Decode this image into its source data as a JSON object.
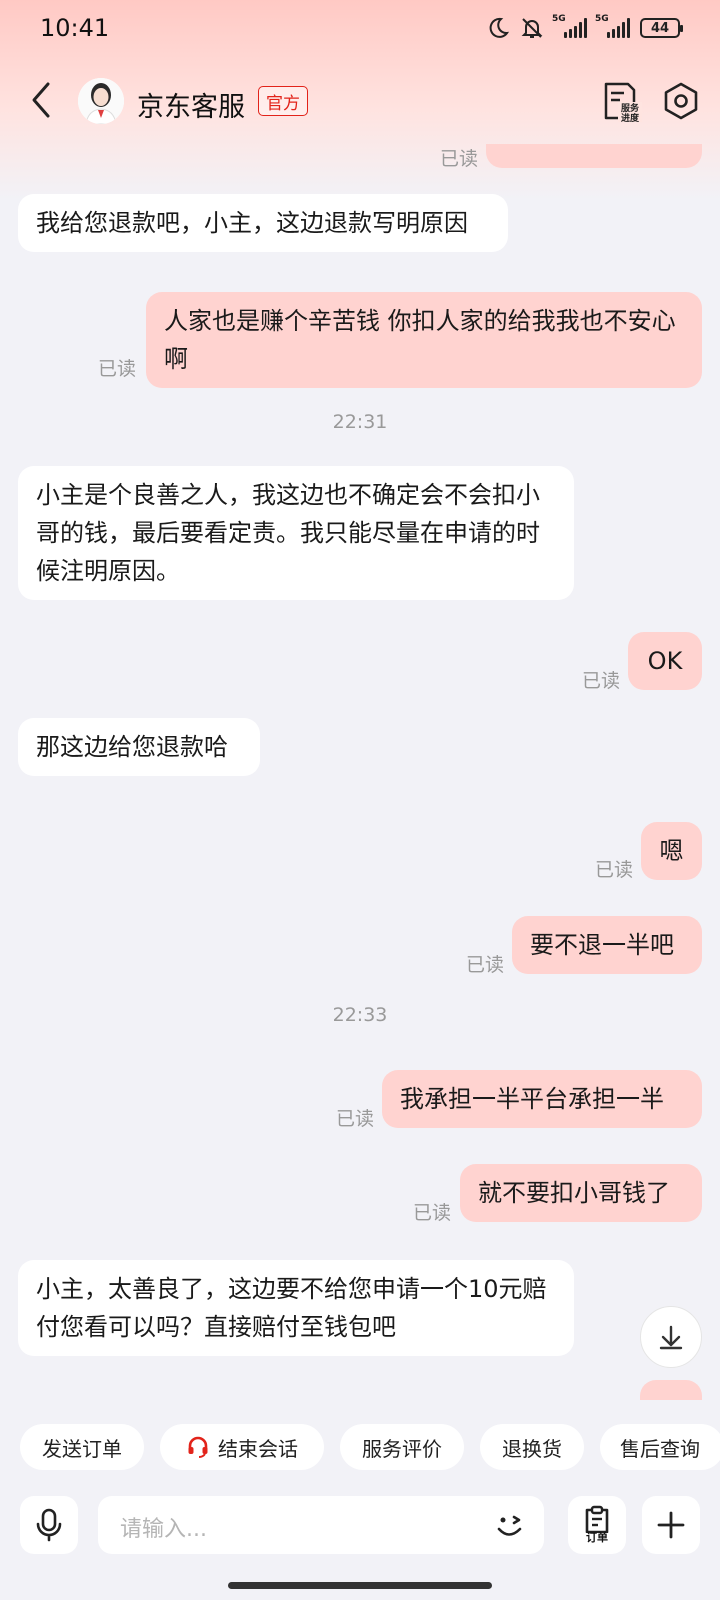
{
  "status_bar": {
    "time": "10:41",
    "battery": "44",
    "net1": "5G",
    "net2": "5G"
  },
  "header": {
    "title": "京东客服",
    "badge": "官方",
    "progress_label_1": "服务",
    "progress_label_2": "进度"
  },
  "messages": [
    {
      "side": "right",
      "text": "",
      "read": "已读",
      "partial": true
    },
    {
      "side": "left",
      "text": "我给您退款吧，小主，这边退款写明原因"
    },
    {
      "side": "right",
      "text": "人家也是赚个辛苦钱  你扣人家的给我我也不安心啊",
      "read": "已读"
    },
    {
      "type": "time",
      "text": "22:31"
    },
    {
      "side": "left",
      "text": "小主是个良善之人，我这边也不确定会不会扣小哥的钱，最后要看定责。我只能尽量在申请的时候注明原因。"
    },
    {
      "side": "right",
      "text": "OK",
      "read": "已读"
    },
    {
      "side": "left",
      "text": "那这边给您退款哈"
    },
    {
      "side": "right",
      "text": "嗯",
      "read": "已读"
    },
    {
      "side": "right",
      "text": "要不退一半吧",
      "read": "已读"
    },
    {
      "type": "time",
      "text": "22:33"
    },
    {
      "side": "right",
      "text": "我承担一半平台承担一半",
      "read": "已读"
    },
    {
      "side": "right",
      "text": "就不要扣小哥钱了",
      "read": "已读"
    },
    {
      "side": "left",
      "text": "小主，太善良了，这边要不给您申请一个10元赔付您看可以吗？直接赔付至钱包吧"
    }
  ],
  "quick_actions": [
    "发送订单",
    "结束会话",
    "服务评价",
    "退换货",
    "售后查询"
  ],
  "input": {
    "placeholder": "请输入...",
    "order_label": "订单"
  },
  "colors": {
    "accent": "#e2231a",
    "bubble_right": "#ffd3d0",
    "bubble_left": "#ffffff",
    "background": "#f2f2f7"
  },
  "icons": {
    "back": "chevron-left-icon",
    "progress": "service-progress-icon",
    "settings": "hexagon-settings-icon",
    "mic": "microphone-icon",
    "emoji": "emoji-icon",
    "order": "order-icon",
    "plus": "plus-icon",
    "headset": "headset-icon",
    "scroll": "arrow-down-icon"
  }
}
